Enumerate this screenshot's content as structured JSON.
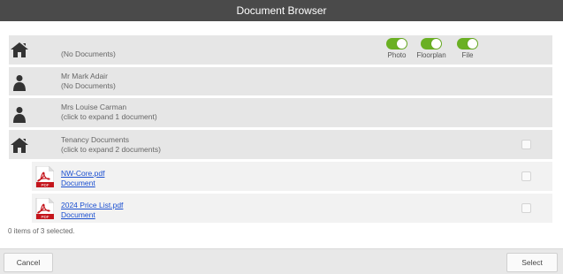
{
  "window": {
    "title": "Document Browser"
  },
  "icons": {
    "house": "house-icon",
    "person": "person-icon",
    "pdf": "pdf-file-icon"
  },
  "colors": {
    "toggle_on": "#6ab023",
    "titlebar": "#4a4a4a",
    "link": "#1a4fd0"
  },
  "toggles": [
    {
      "label": "Photo",
      "on": true
    },
    {
      "label": "Floorplan",
      "on": true
    },
    {
      "label": "File",
      "on": true
    }
  ],
  "rows": [
    {
      "type": "property",
      "icon": "house-icon",
      "line1": "",
      "line2": "(No Documents)"
    },
    {
      "type": "person",
      "icon": "person-icon",
      "line1": "Mr Mark Adair",
      "line2": "(No Documents)"
    },
    {
      "type": "person",
      "icon": "person-icon",
      "line1": "Mrs Louise Carman",
      "line2": "(click to expand 1 document)"
    },
    {
      "type": "group",
      "icon": "house-icon",
      "line1": "Tenancy Documents",
      "line2": "(click to expand 2 documents)"
    }
  ],
  "documents": [
    {
      "name": "NW-Core.pdf",
      "type": "Document",
      "icon_label": "PDF"
    },
    {
      "name": "2024 Price List.pdf",
      "type": "Document",
      "icon_label": "PDF"
    }
  ],
  "status": "0 items of 3 selected.",
  "footer": {
    "cancel_label": "Cancel",
    "select_label": "Select"
  }
}
